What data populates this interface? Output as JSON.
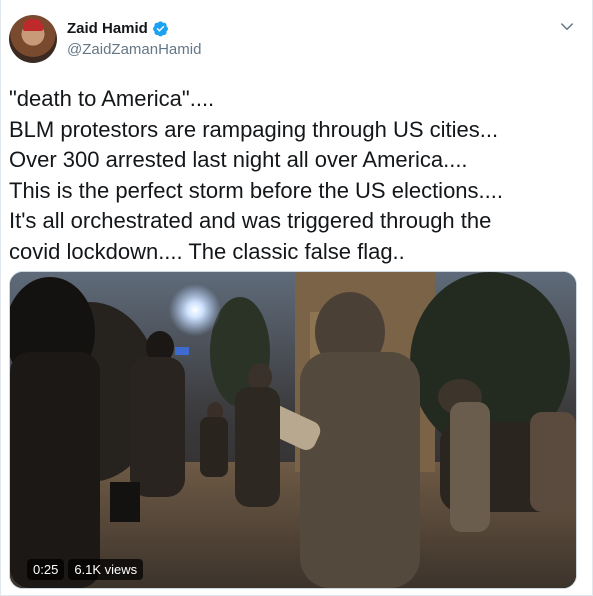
{
  "author": {
    "name": "Zaid Hamid",
    "handle": "@ZaidZamanHamid",
    "verified": true,
    "avatar_icon": "profile-photo"
  },
  "menu_icon": "chevron-down-icon",
  "tweet": {
    "lines": [
      "\"death to America\"....",
      "BLM protestors are rampaging through US cities...",
      "Over 300 arrested last night all over America....",
      "This is the perfect storm before the US elections....",
      "It's all orchestrated and was triggered through the",
      "covid lockdown.... The classic false flag.."
    ]
  },
  "video": {
    "duration": "0:25",
    "views": "6.1K views"
  },
  "colors": {
    "verified_blue": "#1da1f2",
    "handle_gray": "#657786",
    "text": "#14171a"
  }
}
